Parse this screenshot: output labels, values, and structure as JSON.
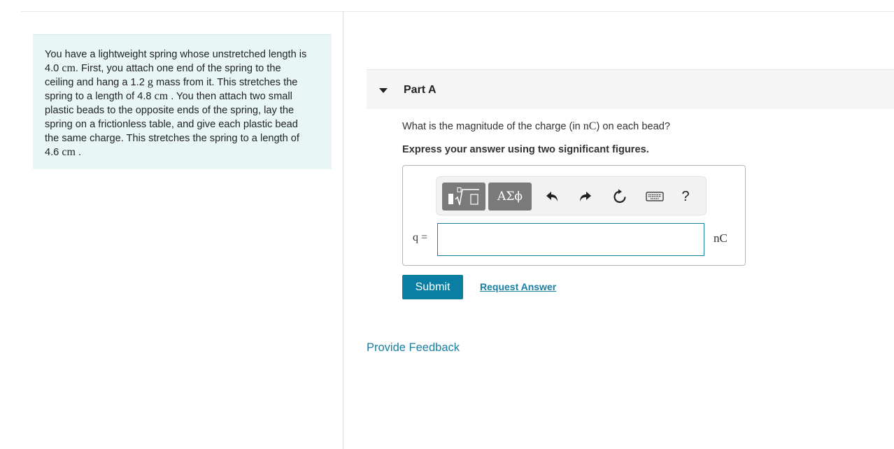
{
  "problem": {
    "t1": "You have a lightweight spring whose unstretched length is ",
    "v1": "4.0",
    "u1": "cm",
    "t2": ". First, you attach one end of the spring to the ceiling and hang a ",
    "v2": "1.2",
    "u2": "g",
    "t3": " mass from it. This stretches the spring to a length of ",
    "v3": "4.8",
    "u3": "cm",
    "t4": " . You then attach two small plastic beads to the opposite ends of the spring, lay the spring on a frictionless table, and give each plastic bead the same charge. This stretches the spring to a length of ",
    "v4": "4.6",
    "u4": "cm",
    "t5": " ."
  },
  "part": {
    "title": "Part A",
    "question_pre": "What is the magnitude of the charge (in ",
    "question_unit": "nC",
    "question_post": ") on each bead?",
    "instruction": "Express your answer using two significant figures."
  },
  "toolbar": {
    "symbols_label": "ΑΣϕ",
    "help_label": "?"
  },
  "answer": {
    "variable_label": "q =",
    "value": "",
    "unit": "nC"
  },
  "actions": {
    "submit_label": "Submit",
    "request_answer_label": "Request Answer",
    "feedback_label": "Provide Feedback"
  },
  "colors": {
    "accent": "#0b7ea3",
    "link": "#1a7fa0",
    "problem_bg": "#e9f6f6"
  }
}
